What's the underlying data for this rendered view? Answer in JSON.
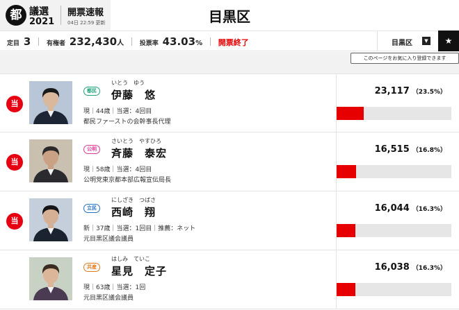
{
  "header": {
    "logo_kanji": "都",
    "logo_title": "議選",
    "logo_year": "2021",
    "flash": "開票速報",
    "updated": "04日 22:59 更新",
    "page_title": "目黒区"
  },
  "info": {
    "seats_label": "定目",
    "seats_value": "3",
    "voters_label": "有権者",
    "voters_value": "232,430",
    "voters_unit": "人",
    "turnout_label": "投票率",
    "turnout_value": "43.03",
    "turnout_unit": "%",
    "status": "開票終了"
  },
  "selector": {
    "label": "目黒区",
    "arrow": "▼"
  },
  "favorite": {
    "icon": "★",
    "tooltip": "このページをお気に入り登録できます"
  },
  "candidates": [
    {
      "elected": "当",
      "party": "都民",
      "party_color": "#1aa37a",
      "kana": "いとう　ゆう",
      "name": "伊藤　悠",
      "status": "現",
      "age": "44歳",
      "wins": "当選：4回目",
      "endorse": "",
      "career": "都民ファーストの会幹事長代理",
      "votes": "23,117",
      "pct": "（23.5%）",
      "share": 0.235,
      "photo": {
        "bg": "#b8c6d8",
        "skin": "#d9b89b",
        "hair": "#1a1a1a",
        "suit": "#1d2433"
      }
    },
    {
      "elected": "当",
      "party": "公明",
      "party_color": "#e4389c",
      "kana": "さいとう　やすひろ",
      "name": "斉藤　泰宏",
      "status": "現",
      "age": "58歳",
      "wins": "当選：4回目",
      "endorse": "",
      "career": "公明党東京都本部広報宣伝局長",
      "votes": "16,515",
      "pct": "（16.8%）",
      "share": 0.168,
      "photo": {
        "bg": "#c9c0b0",
        "skin": "#c9a184",
        "hair": "#2a2a2a",
        "suit": "#2b2b2f"
      }
    },
    {
      "elected": "当",
      "party": "立民",
      "party_color": "#1f6fc2",
      "kana": "にしざき　つばさ",
      "name": "西崎　翔",
      "status": "新",
      "age": "37歳",
      "wins": "当選：1回目",
      "endorse": "推薦：ネット",
      "career": "元目黒区議会議員",
      "votes": "16,044",
      "pct": "（16.3%）",
      "share": 0.163,
      "photo": {
        "bg": "#c5cfdc",
        "skin": "#d6b094",
        "hair": "#151515",
        "suit": "#1b2230"
      }
    },
    {
      "elected": "",
      "party": "共産",
      "party_color": "#e07a1a",
      "kana": "はしみ　ていこ",
      "name": "星見　定子",
      "status": "現",
      "age": "63歳",
      "wins": "当選：1回",
      "endorse": "",
      "career": "元目黒区議会議員",
      "votes": "16,038",
      "pct": "（16.3%）",
      "share": 0.163,
      "photo": {
        "bg": "#c7d2c4",
        "skin": "#dcb699",
        "hair": "#3a2c22",
        "suit": "#4b3b52"
      }
    }
  ]
}
